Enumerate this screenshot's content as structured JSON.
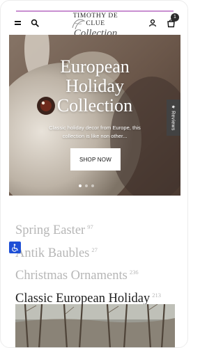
{
  "header": {
    "logo_line1": "TIMOTHY DE CLUE",
    "logo_line2": "Collection",
    "cart_count": "1",
    "icons": [
      "menu-icon",
      "search-icon",
      "account-icon",
      "cart-icon"
    ]
  },
  "hero": {
    "title": "European\nHoliday\nCollection",
    "subtitle": "Classic holiday decor from Europe, this collection is like non other...",
    "button_label": "SHOP NOW",
    "slide_count": 3,
    "active_slide": 1
  },
  "reviews_tab": {
    "label": "★ Reviews"
  },
  "collections": [
    {
      "name": "Spring Easter",
      "count": "97",
      "active": false
    },
    {
      "name": "Antik Baubles",
      "count": "27",
      "active": false
    },
    {
      "name": "Christmas Ornaments",
      "count": "236",
      "active": false
    },
    {
      "name": "Classic European Holiday",
      "count": "213",
      "active": true
    }
  ],
  "colors": {
    "accent_line": "#c88fd1",
    "accessibility_button": "#1e4fd6",
    "reviews_tab": "#424242",
    "inactive_collection": "#b6b6b6"
  }
}
